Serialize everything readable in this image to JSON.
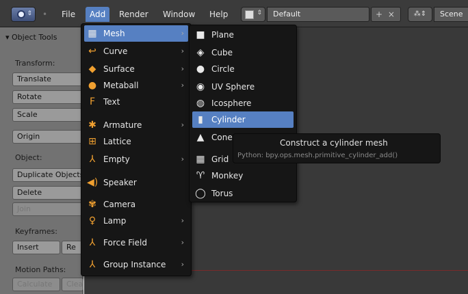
{
  "header": {
    "menus": [
      {
        "label": "File"
      },
      {
        "label": "Add"
      },
      {
        "label": "Render"
      },
      {
        "label": "Window"
      },
      {
        "label": "Help"
      }
    ],
    "layout_value": "Default",
    "layout_buttons": "+ ×",
    "scene_value": "Scene"
  },
  "toolshelf": {
    "title": "▾ Object Tools",
    "transform_label": "Transform:",
    "translate": "Translate",
    "rotate": "Rotate",
    "scale": "Scale",
    "origin": "Origin",
    "object_label": "Object:",
    "duplicate": "Duplicate Objects",
    "delete": "Delete",
    "join": "Join",
    "keyframes_label": "Keyframes:",
    "insert": "Insert",
    "remove": "Re",
    "motion_label": "Motion Paths:",
    "calculate": "Calculate",
    "clear": "Clear"
  },
  "add_menu": {
    "items": [
      {
        "label": "Mesh",
        "icon": "mesh-icon"
      },
      {
        "label": "Curve",
        "icon": "curve-icon"
      },
      {
        "label": "Surface",
        "icon": "surface-icon"
      },
      {
        "label": "Metaball",
        "icon": "metaball-icon"
      },
      {
        "label": "Text",
        "icon": "text-icon"
      },
      {
        "label": "Armature",
        "icon": "armature-icon"
      },
      {
        "label": "Lattice",
        "icon": "lattice-icon"
      },
      {
        "label": "Empty",
        "icon": "empty-icon"
      },
      {
        "label": "Speaker",
        "icon": "speaker-icon"
      },
      {
        "label": "Camera",
        "icon": "camera-icon"
      },
      {
        "label": "Lamp",
        "icon": "lamp-icon"
      },
      {
        "label": "Force Field",
        "icon": "force-field-icon"
      },
      {
        "label": "Group Instance",
        "icon": "group-instance-icon"
      }
    ]
  },
  "mesh_menu": {
    "items": [
      {
        "label": "Plane",
        "icon": "plane-icon"
      },
      {
        "label": "Cube",
        "icon": "cube-icon"
      },
      {
        "label": "Circle",
        "icon": "circle-icon"
      },
      {
        "label": "UV Sphere",
        "icon": "uv-sphere-icon"
      },
      {
        "label": "Icosphere",
        "icon": "icosphere-icon"
      },
      {
        "label": "Cylinder",
        "icon": "cylinder-icon"
      },
      {
        "label": "Cone",
        "icon": "cone-icon"
      },
      {
        "label": "Grid",
        "icon": "grid-icon"
      },
      {
        "label": "Monkey",
        "icon": "monkey-icon"
      },
      {
        "label": "Torus",
        "icon": "torus-icon"
      }
    ]
  },
  "tooltip": {
    "title": "Construct a cylinder mesh",
    "python": "Python: bpy.ops.mesh.primitive_cylinder_add()"
  },
  "colors": {
    "highlight": "#5680c2",
    "menu_bg": "#161616",
    "icon_orange": "#f0a030"
  }
}
